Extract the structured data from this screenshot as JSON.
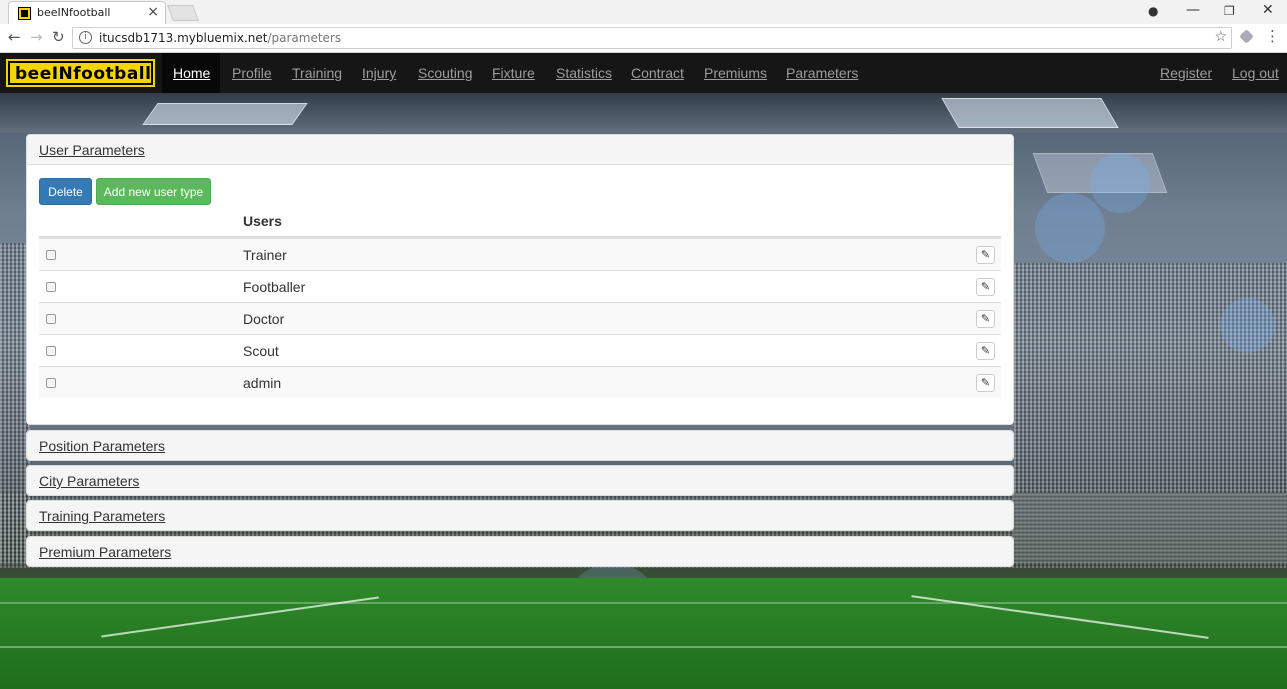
{
  "browser": {
    "tab_title": "beeINfootball",
    "tab_close_icon": "×",
    "url_host": "itucsdb1713.mybluemix.net",
    "url_path": "/parameters",
    "back_icon": "←",
    "forward_icon": "→",
    "reload_icon": "↻",
    "info_icon": "i",
    "star_icon": "☆",
    "menu_icon": "⋮",
    "account_icon": "●",
    "minimize_icon": "—",
    "restore_icon": "❐",
    "close_icon": "✕"
  },
  "navbar": {
    "brand": "beeINfootball",
    "items": [
      {
        "label": "Home",
        "active": true
      },
      {
        "label": "Profile"
      },
      {
        "label": "Training"
      },
      {
        "label": "Injury"
      },
      {
        "label": "Scouting"
      },
      {
        "label": "Fixture"
      },
      {
        "label": "Statistics"
      },
      {
        "label": "Contract"
      },
      {
        "label": "Premiums"
      },
      {
        "label": "Parameters"
      }
    ],
    "register": "Register",
    "logout": "Log out"
  },
  "user_panel": {
    "title": "User Parameters",
    "delete_label": "Delete",
    "add_label": "Add new user type",
    "column_header": "Users",
    "edit_icon": "✎",
    "rows": [
      "Trainer",
      "Footballer",
      "Doctor",
      "Scout",
      "admin"
    ]
  },
  "collapsed_panels": [
    "Position Parameters",
    "City Parameters",
    "Training Parameters",
    "Premium Parameters"
  ],
  "colors": {
    "navbar_bg": "#161616",
    "brand_yellow": "#f5d400",
    "delete_blue": "#337ab7",
    "add_green": "#5cb85c"
  }
}
